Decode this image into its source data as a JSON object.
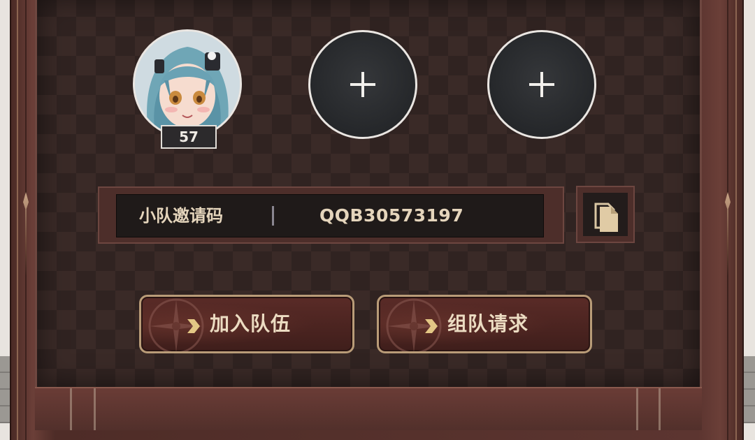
{
  "team": {
    "members": [
      {
        "slot": 1,
        "occupied": true,
        "level": "57"
      },
      {
        "slot": 2,
        "occupied": false
      },
      {
        "slot": 3,
        "occupied": false
      }
    ]
  },
  "invite": {
    "label": "小队邀请码",
    "code": "QQB30573197"
  },
  "actions": {
    "join_label": "加入队伍",
    "request_label": "组队请求"
  },
  "colors": {
    "panel_bg": "#302321",
    "frame": "#5c3530",
    "accent_text": "#e5d5bc",
    "button_border": "#b99c78"
  }
}
